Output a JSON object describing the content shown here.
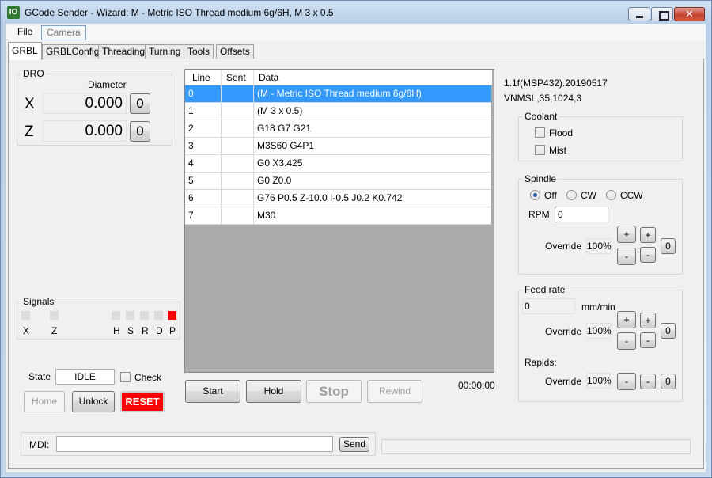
{
  "window": {
    "title": "GCode Sender - Wizard: M - Metric ISO Thread medium 6g/6H, M 3 x 0.5",
    "icon_text": "IO",
    "close_glyph": "✕"
  },
  "menu": {
    "file": "File",
    "camera": "Camera"
  },
  "tabs": [
    "GRBL",
    "GRBLConfig",
    "Threading",
    "Turning",
    "Tools",
    "Offsets"
  ],
  "dro": {
    "title": "DRO",
    "diameter_label": "Diameter",
    "x_label": "X",
    "x_value": "0.000",
    "z_label": "Z",
    "z_value": "0.000",
    "zero_label": "0"
  },
  "signals": {
    "title": "Signals",
    "labels": [
      "X",
      "Z",
      "H",
      "S",
      "R",
      "D",
      "P"
    ],
    "active_color": "#ff0000",
    "inactive_color": "#dcdcdc"
  },
  "state": {
    "label": "State",
    "value": "IDLE",
    "check_label": "Check",
    "home_label": "Home",
    "unlock_label": "Unlock",
    "reset_label": "RESET",
    "reset_color": "#ff0000"
  },
  "mdi": {
    "label": "MDI:",
    "value": "",
    "send_label": "Send"
  },
  "gcode": {
    "columns": [
      "Line",
      "Sent",
      "Data"
    ],
    "rows": [
      {
        "line": "0",
        "sent": "",
        "data": "(M - Metric ISO Thread medium 6g/6H)"
      },
      {
        "line": "1",
        "sent": "",
        "data": "(M 3 x 0.5)"
      },
      {
        "line": "2",
        "sent": "",
        "data": "G18 G7 G21"
      },
      {
        "line": "3",
        "sent": "",
        "data": "M3S60 G4P1"
      },
      {
        "line": "4",
        "sent": "",
        "data": "G0 X3.425"
      },
      {
        "line": "5",
        "sent": "",
        "data": "G0 Z0.0"
      },
      {
        "line": "6",
        "sent": "",
        "data": "G76 P0.5 Z-10.0 I-0.5 J0.2 K0.742"
      },
      {
        "line": "7",
        "sent": "",
        "data": "M30"
      }
    ],
    "selected_row": 0
  },
  "job": {
    "start_label": "Start",
    "hold_label": "Hold",
    "stop_label": "Stop",
    "rewind_label": "Rewind",
    "elapsed": "00:00:00"
  },
  "info": {
    "version": "1.1f(MSP432).20190517",
    "options": "VNMSL,35,1024,3"
  },
  "coolant": {
    "title": "Coolant",
    "flood_label": "Flood",
    "mist_label": "Mist"
  },
  "spindle": {
    "title": "Spindle",
    "off_label": "Off",
    "cw_label": "CW",
    "ccw_label": "CCW",
    "rpm_label": "RPM",
    "rpm_value": "0",
    "override_label": "Override",
    "override_value": "100%",
    "plus": "+",
    "minus": "-",
    "zero": "0"
  },
  "feed": {
    "title": "Feed rate",
    "value": "0",
    "unit": "mm/min",
    "override_label": "Override",
    "override_value": "100%",
    "rapids_label": "Rapids:",
    "rapids_override_label": "Override",
    "rapids_override_value": "100%",
    "plus": "+",
    "minus": "-",
    "zero": "0"
  }
}
